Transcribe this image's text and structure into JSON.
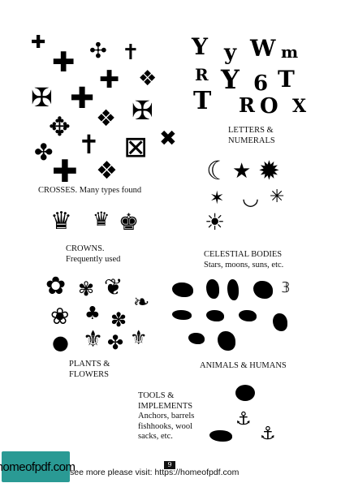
{
  "sections": {
    "crosses": {
      "lines": [
        "CROSSES. Many types found"
      ]
    },
    "letters": {
      "lines": [
        "LETTERS &",
        "NUMERALS"
      ],
      "symbols": [
        "Y",
        "y",
        "W",
        "m",
        "R",
        "Y",
        "6",
        "T",
        "T",
        "R",
        "O",
        "X"
      ]
    },
    "crowns": {
      "lines": [
        "CROWNS.",
        "Frequently used"
      ]
    },
    "celestial": {
      "lines": [
        "CELESTIAL BODIES",
        "Stars, moons, suns, etc."
      ]
    },
    "plants": {
      "lines": [
        "PLANTS &",
        "FLOWERS"
      ]
    },
    "animals": {
      "lines": [
        "ANIMALS & HUMANS"
      ]
    },
    "tools": {
      "lines": [
        "TOOLS &",
        "IMPLEMENTS",
        "Anchors, barrels",
        "fishhooks, wool",
        "sacks, etc."
      ]
    }
  },
  "footer": {
    "logo": "homeofpdf.com",
    "text": "see more please visit: https://homeofpdf.com",
    "page_number": "9"
  }
}
